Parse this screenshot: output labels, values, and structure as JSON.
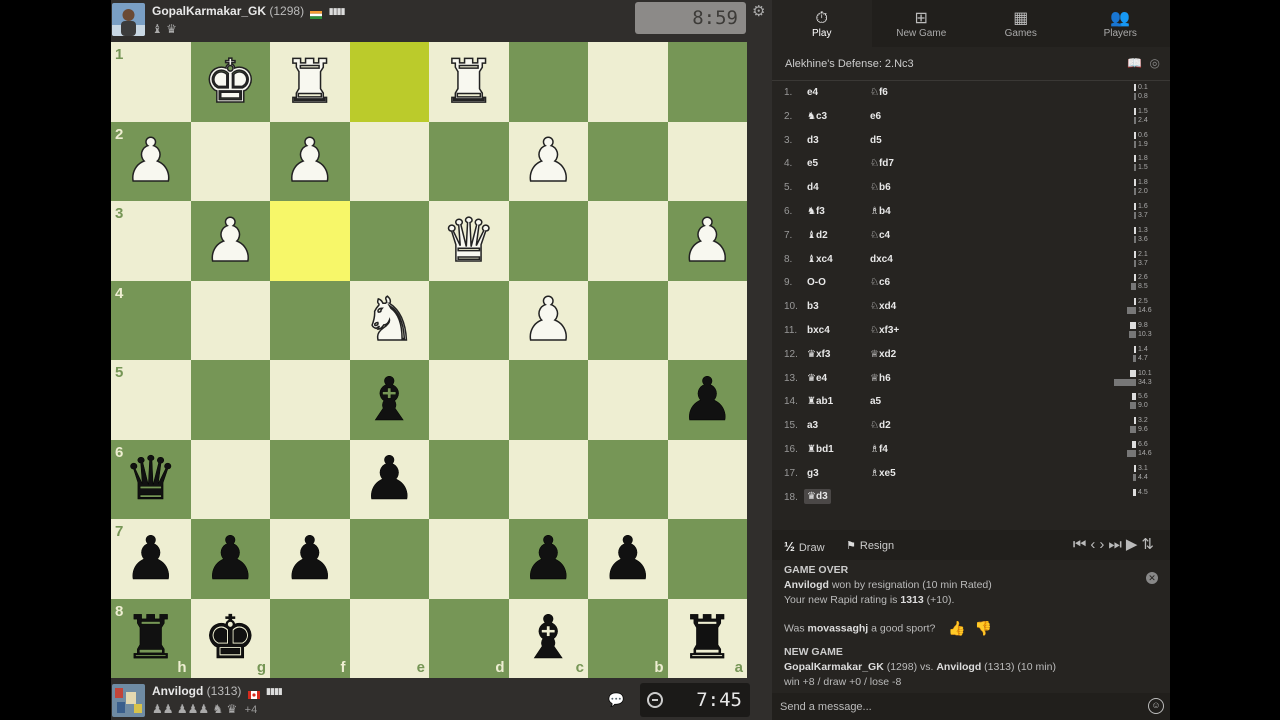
{
  "top_player": {
    "name": "GopalKarmakar_GK",
    "rating": "(1298)",
    "flag": "India",
    "captured": "♝ ♛",
    "clock": "8:59"
  },
  "bottom_player": {
    "name": "Anvilogd",
    "rating": "(1313)",
    "flag": "Canada",
    "captured": "♟♟ ♟♟♟ ♞ ♛",
    "material": "+4",
    "clock": "7:45"
  },
  "board": {
    "orientation": "black",
    "rank_labels": [
      "1",
      "2",
      "3",
      "4",
      "5",
      "6",
      "7",
      "8"
    ],
    "file_labels": [
      "h",
      "g",
      "f",
      "e",
      "d",
      "c",
      "b",
      "a"
    ],
    "highlights": [
      "f3",
      "e1"
    ],
    "squares": [
      [
        "",
        "wK",
        "wR",
        "",
        "wR",
        "",
        "",
        ""
      ],
      [
        "wP",
        "",
        "wP",
        "",
        "",
        "wP",
        "",
        ""
      ],
      [
        "",
        "wP",
        "",
        "",
        "wQ",
        "",
        "",
        "wP"
      ],
      [
        "",
        "",
        "",
        "wN",
        "",
        "wP",
        "",
        ""
      ],
      [
        "",
        "",
        "",
        "bB",
        "",
        "",
        "",
        "bP"
      ],
      [
        "bQ",
        "",
        "",
        "bP",
        "",
        "",
        "",
        ""
      ],
      [
        "bP",
        "bP",
        "bP",
        "",
        "",
        "bP",
        "bP",
        ""
      ],
      [
        "bR",
        "bK",
        "",
        "",
        "",
        "bB",
        "",
        "bR"
      ]
    ]
  },
  "sidebar": {
    "tabs": [
      {
        "label": "Play",
        "icon": "stopwatch-icon"
      },
      {
        "label": "New Game",
        "icon": "plus-square-icon"
      },
      {
        "label": "Games",
        "icon": "chessboard-icon"
      },
      {
        "label": "Players",
        "icon": "players-icon"
      }
    ],
    "opening": "Alekhine's Defense: 2.Nc3",
    "moves": [
      {
        "n": "1.",
        "w": "e4",
        "b": "♘f6",
        "wt": "0.1",
        "bt": "0.8",
        "wv": 0.1,
        "bv": 0.8
      },
      {
        "n": "2.",
        "w": "♞c3",
        "b": "e6",
        "wt": "1.5",
        "bt": "2.4",
        "wv": 1.5,
        "bv": 2.4
      },
      {
        "n": "3.",
        "w": "d3",
        "b": "d5",
        "wt": "0.6",
        "bt": "1.9",
        "wv": 0.6,
        "bv": 1.9
      },
      {
        "n": "4.",
        "w": "e5",
        "b": "♘fd7",
        "wt": "1.8",
        "bt": "1.5",
        "wv": 1.8,
        "bv": 1.5
      },
      {
        "n": "5.",
        "w": "d4",
        "b": "♘b6",
        "wt": "1.8",
        "bt": "2.0",
        "wv": 1.8,
        "bv": 2.0
      },
      {
        "n": "6.",
        "w": "♞f3",
        "b": "♗b4",
        "wt": "1.6",
        "bt": "3.7",
        "wv": 1.6,
        "bv": 3.7
      },
      {
        "n": "7.",
        "w": "♝d2",
        "b": "♘c4",
        "wt": "1.3",
        "bt": "3.6",
        "wv": 1.3,
        "bv": 3.6
      },
      {
        "n": "8.",
        "w": "♝xc4",
        "b": "dxc4",
        "wt": "2.1",
        "bt": "3.7",
        "wv": 2.1,
        "bv": 3.7
      },
      {
        "n": "9.",
        "w": "O-O",
        "b": "♘c6",
        "wt": "2.6",
        "bt": "8.5",
        "wv": 2.6,
        "bv": 8.5
      },
      {
        "n": "10.",
        "w": "b3",
        "b": "♘xd4",
        "wt": "2.5",
        "bt": "14.6",
        "wv": 2.5,
        "bv": 14.6
      },
      {
        "n": "11.",
        "w": "bxc4",
        "b": "♘xf3+",
        "wt": "9.8",
        "bt": "10.3",
        "wv": 9.8,
        "bv": 10.3
      },
      {
        "n": "12.",
        "w": "♛xf3",
        "b": "♕xd2",
        "wt": "1.4",
        "bt": "4.7",
        "wv": 1.4,
        "bv": 4.7
      },
      {
        "n": "13.",
        "w": "♛e4",
        "b": "♕h6",
        "wt": "10.1",
        "bt": "34.3",
        "wv": 10.1,
        "bv": 34.3
      },
      {
        "n": "14.",
        "w": "♜ab1",
        "b": "a5",
        "wt": "5.6",
        "bt": "9.0",
        "wv": 5.6,
        "bv": 9.0
      },
      {
        "n": "15.",
        "w": "a3",
        "b": "♘d2",
        "wt": "3.2",
        "bt": "9.6",
        "wv": 3.2,
        "bv": 9.6
      },
      {
        "n": "16.",
        "w": "♜bd1",
        "b": "♗f4",
        "wt": "6.6",
        "bt": "14.6",
        "wv": 6.6,
        "bv": 14.6
      },
      {
        "n": "17.",
        "w": "g3",
        "b": "♗xe5",
        "wt": "3.1",
        "bt": "4.4",
        "wv": 3.1,
        "bv": 4.4
      },
      {
        "n": "18.",
        "w": "♛d3",
        "b": "",
        "wt": "4.5",
        "bt": "",
        "wv": 4.5,
        "bv": 0
      }
    ],
    "draw_label": "Draw",
    "draw_symbol": "½",
    "resign_label": "Resign",
    "result": {
      "heading": "GAME OVER",
      "winner": "Anvilogd",
      "won_text": " won by resignation (10 min Rated)",
      "rating_prefix": "Your new Rapid rating is ",
      "new_rating": "1313",
      "rating_delta": " (+10).",
      "sport_prefix": "Was ",
      "sport_name": "movassaghj",
      "sport_suffix": " a good sport?",
      "new_game_heading": "NEW GAME",
      "ng_p1": "GopalKarmakar_GK",
      "ng_p1_rating": " (1298) vs. ",
      "ng_p2": "Anvilogd",
      "ng_p2_rating": " (1313) (10 min)",
      "stakes": "win +8 / draw +0 / lose -8"
    },
    "message_placeholder": "Send a message..."
  }
}
